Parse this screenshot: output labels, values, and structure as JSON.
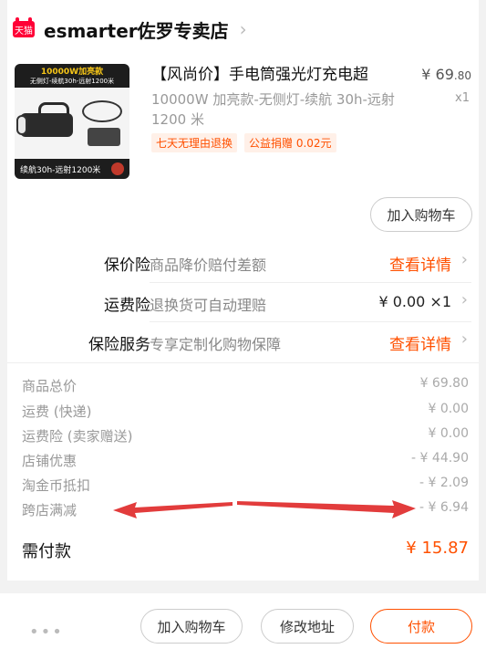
{
  "shop": {
    "badge": "天猫",
    "name": "esmarter佐罗专卖店",
    "chevron": "›"
  },
  "product": {
    "image_top_line": "10000W加亮款",
    "image_sub_line": "无侧灯-续航30h-远射1200米",
    "image_bottom_line": "续航30h-远射1200米",
    "title": "【风尚价】手电筒强光灯充电超",
    "spec": "10000W 加亮款-无侧灯-续航 30h-远射 1200 米",
    "tags": [
      "七天无理由退换",
      "公益捐赠 0.02元"
    ],
    "price_symbol": "¥",
    "price_int": "69",
    "price_dec": ".80",
    "qty": "x1"
  },
  "add_to_cart": "加入购物车",
  "services": [
    {
      "label": "保价险",
      "desc": "商品降价赔付差额",
      "action": "查看详情",
      "arrow": "›"
    },
    {
      "label": "运费险",
      "desc": "退换货可自动理赔",
      "value": "¥ 0.00 ×1",
      "arrow": "›"
    },
    {
      "label": "保险服务",
      "desc": "专享定制化购物保障",
      "action": "查看详情",
      "arrow": "›"
    }
  ],
  "summary": [
    {
      "key": "商品总价",
      "value": "¥ 69.80"
    },
    {
      "key": "运费 (快递)",
      "value": "¥ 0.00"
    },
    {
      "key": "运费险 (卖家赠送)",
      "value": "¥ 0.00"
    },
    {
      "key": "店铺优惠",
      "value": "- ¥ 44.90"
    },
    {
      "key": "淘金币抵扣",
      "value": "- ¥ 2.09"
    },
    {
      "key": "跨店满减",
      "value": "- ¥ 6.94"
    }
  ],
  "total": {
    "key": "需付款",
    "value": "¥ 15.87"
  },
  "bottom": {
    "more": "•••",
    "add_to_cart": "加入购物车",
    "modify_address": "修改地址",
    "pay": "付款"
  },
  "colors": {
    "accent": "#ff5000",
    "tmall": "#ff0036",
    "annotation_arrow": "#e23c3c"
  }
}
